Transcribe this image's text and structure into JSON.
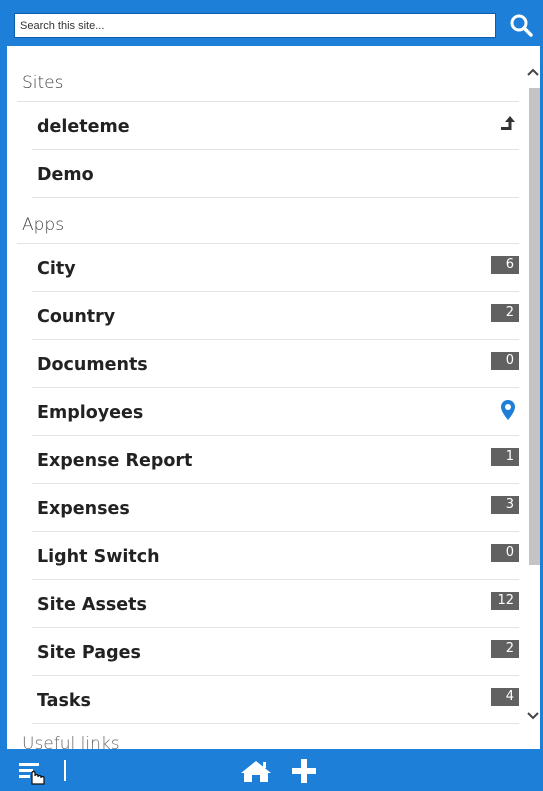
{
  "search": {
    "placeholder": "Search this site..."
  },
  "colors": {
    "accent": "#1e7fd8",
    "badge": "#616161",
    "location_pin": "#1e7fd8"
  },
  "sections": {
    "sites": {
      "title": "Sites",
      "items": [
        {
          "label": "deleteme",
          "icon": "upload-arrow-icon"
        },
        {
          "label": "Demo"
        }
      ]
    },
    "apps": {
      "title": "Apps",
      "items": [
        {
          "label": "City",
          "count": "6"
        },
        {
          "label": "Country",
          "count": "2"
        },
        {
          "label": "Documents",
          "count": "0"
        },
        {
          "label": "Employees",
          "icon": "location-pin-icon"
        },
        {
          "label": "Expense Report",
          "count": "1"
        },
        {
          "label": "Expenses",
          "count": "3"
        },
        {
          "label": "Light Switch",
          "count": "0"
        },
        {
          "label": "Site Assets",
          "count": "12"
        },
        {
          "label": "Site Pages",
          "count": "2"
        },
        {
          "label": "Tasks",
          "count": "4"
        }
      ]
    },
    "useful_links": {
      "title": "Useful links"
    }
  },
  "toolbar": {
    "icons": [
      "menu-icon",
      "home-icon",
      "plus-icon"
    ]
  }
}
